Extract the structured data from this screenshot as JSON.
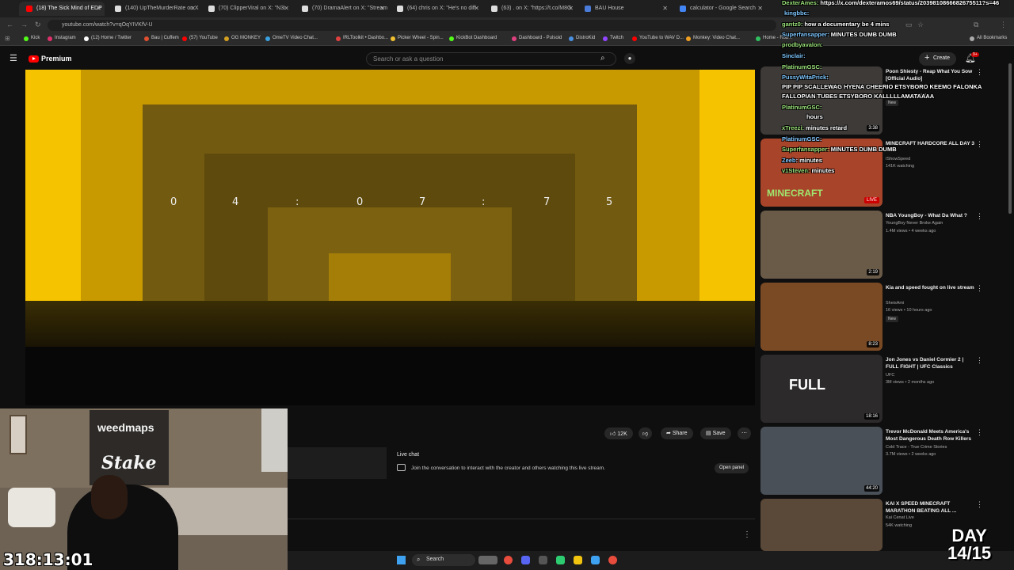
{
  "tabs": [
    {
      "label": "(18) The Sick Mind of EDP",
      "color": "#ff0000"
    },
    {
      "label": "(140) UpTheMurderRate on X",
      "color": "#ffffff"
    },
    {
      "label": "(70) ClipperViral on X: \"N3i",
      "color": "#ffffff"
    },
    {
      "label": "(70) DramaAlert on X: \"Stream",
      "color": "#ffffff"
    },
    {
      "label": "(64) chris on X: \"He's no diff",
      "color": "#ffffff"
    },
    {
      "label": "(63) . on X: \"https://t.co/M8G",
      "color": "#ffffff"
    },
    {
      "label": "BAU House",
      "color": "#4a7bd8"
    },
    {
      "label": "calculator - Google Search",
      "color": "#4285f4"
    }
  ],
  "address": {
    "url": "youtube.com/watch?v=qOqYIVKfV-U"
  },
  "bookmarks": [
    {
      "label": "Kick",
      "color": "#53fc18"
    },
    {
      "label": "Instagram",
      "color": "#e1306c"
    },
    {
      "label": "(12) Home / Twitter",
      "color": "#ffffff"
    },
    {
      "label": "Bau | Cuffem",
      "color": "#e05030"
    },
    {
      "label": "(57) YouTube",
      "color": "#ff0000"
    },
    {
      "label": "OG MONKEY",
      "color": "#d4a020"
    },
    {
      "label": "OmeTV Video Chat...",
      "color": "#3aa0e0"
    },
    {
      "label": "IRLToolkit • Dashbo...",
      "color": "#e04040"
    },
    {
      "label": "Picker Wheel - Spin...",
      "color": "#f0c030"
    },
    {
      "label": "KickBot Dashboard",
      "color": "#53fc18"
    },
    {
      "label": "Dashboard - Pulsoid",
      "color": "#e04080"
    },
    {
      "label": "DistroKid",
      "color": "#4a90e2"
    },
    {
      "label": "Twitch",
      "color": "#9146ff"
    },
    {
      "label": "YouTube to WAV D...",
      "color": "#ff0000"
    },
    {
      "label": "Monkey: Video Chat...",
      "color": "#f0a020"
    },
    {
      "label": "Home - Rob...",
      "color": "#30c060"
    },
    {
      "label": "All Bookmarks",
      "color": "#aaaaaa"
    }
  ],
  "youtube": {
    "brand": "Premium",
    "search_placeholder": "Search or ask a question",
    "create_label": "Create",
    "notif_count": "9+"
  },
  "video": {
    "digits": [
      "0",
      "4",
      ":",
      "0",
      "7",
      ":",
      "7",
      "5"
    ]
  },
  "actions": {
    "likes": "12K",
    "share": "Share",
    "save": "Save"
  },
  "livechat": {
    "title": "Live chat",
    "description": "Join the conversation to interact with the creator and others watching this live stream.",
    "open_panel": "Open panel"
  },
  "webcam": {
    "banner1": "weedmaps",
    "banner2": "Stake"
  },
  "timer": "318:13:01",
  "taskbar": {
    "search": "Search"
  },
  "recommendations": [
    {
      "title": "Poon Shiesty - Reap What You Sow [Official Audio]",
      "channel": "",
      "meta": "ago",
      "badge": "New",
      "duration": "3:38"
    },
    {
      "title": "MINECRAFT HARDCORE ALL DAY 3",
      "channel": "IShowSpeed",
      "meta": "141K watching",
      "badge": "",
      "duration": "LIVE"
    },
    {
      "title": "NBA YoungBoy - What Da What ?",
      "channel": "YoungBoy Never Broke Again",
      "meta": "1.4M views • 4 weeks ago",
      "badge": "",
      "duration": "2:19"
    },
    {
      "title": "Kia and speed fought on live stream",
      "channel": "SheisAmi",
      "meta": "16 views • 10 hours ago",
      "badge": "New",
      "duration": "8:23"
    },
    {
      "title": "Jon Jones vs Daniel Cormier 2 | FULL FIGHT | UFC Classics",
      "channel": "UFC",
      "meta": "3M views • 2 months ago",
      "badge": "",
      "duration": "18:16"
    },
    {
      "title": "Trevor McDonald Meets America's Most Dangerous Death Row Killers",
      "channel": "Cold Trace - True Crime Stories",
      "meta": "3.7M views • 2 weeks ago",
      "badge": "",
      "duration": "44:20"
    },
    {
      "title": "KAI X SPEED MINECRAFT MARATHON BEATING ALL ...",
      "channel": "Kai Cenat Live",
      "meta": "54K watching",
      "badge": "",
      "duration": ""
    }
  ],
  "overlay_chat": [
    {
      "user": "DexterAmes:",
      "msg": "https://x.com/dexteramos69/status/2039810866682675511?s=46"
    },
    {
      "user": "kingbbc:",
      "msg": ""
    },
    {
      "user": "gantz0:",
      "msg": "how a documentary be 4 mins"
    },
    {
      "user": "Superfansapper:",
      "msg": "MINUTES DUMB DUMB"
    },
    {
      "user": "prodbyavalon:",
      "msg": ""
    },
    {
      "user": "Sinclair:",
      "msg": ""
    },
    {
      "user": "PlatinumGSC:",
      "msg": ""
    },
    {
      "user": "PussyWitaPrick:",
      "msg": ""
    },
    {
      "user": "",
      "msg": "PIP PIP SCALLEWAG HYENA CHEERIO ETSYBORO KEEMO FALONKA"
    },
    {
      "user": "",
      "msg": "FALLOPIAN TUBES ETSYBORO KALLLLLAMATAAAA"
    },
    {
      "user": "PlatinumGSC:",
      "msg": ""
    },
    {
      "user": "",
      "msg": "hours"
    },
    {
      "user": "xTreezi:",
      "msg": "minutes retard"
    },
    {
      "user": "PlatinumGSC:",
      "msg": ""
    },
    {
      "user": "Superfansapper:",
      "msg": "MINUTES DUMB DUMB"
    },
    {
      "user": "Zeeb:",
      "msg": "minutes"
    },
    {
      "user": "v1Steven:",
      "msg": "minutes"
    }
  ],
  "day_overlay": {
    "line1": "DAY",
    "line2": "14/15"
  },
  "colors": {
    "video_yellow": "#f5c300",
    "yt_red": "#ff0000",
    "bg": "#0f0f0f"
  }
}
